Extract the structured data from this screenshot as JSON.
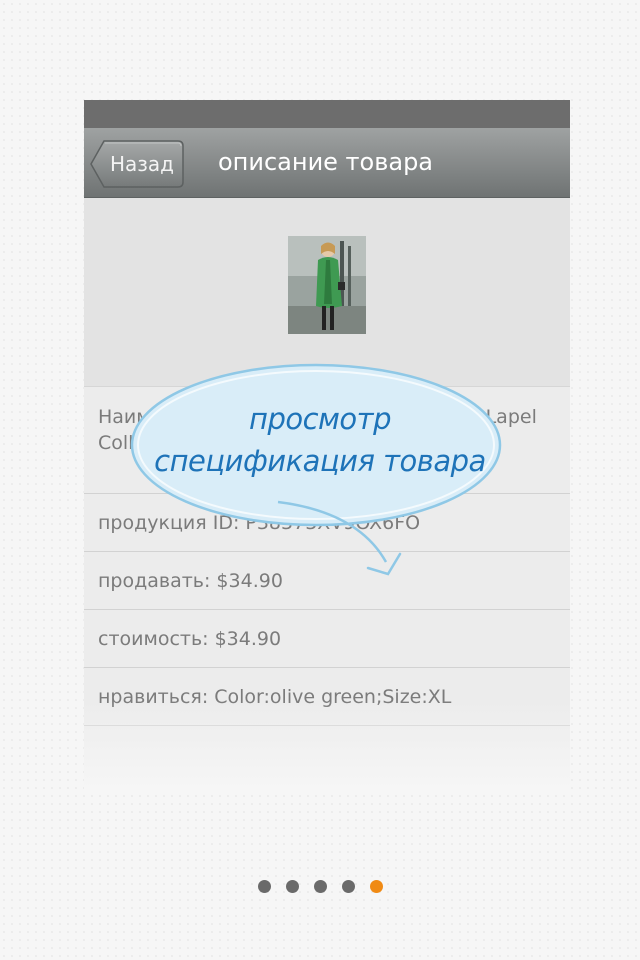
{
  "header": {
    "back_label": "Назад",
    "title": "описание товара"
  },
  "product": {
    "image_alt": "product-photo",
    "name": "Наименование: Slim Wool Blend Zipper Lapel Collar Woman Green Coat",
    "product_id": "продукция ID: P38373XV9OX6FO",
    "sell_price": "продавать: $34.90",
    "cost": "стоимость: $34.90",
    "option": "нравиться: Color:olive green;Size:XL"
  },
  "callout": {
    "line1": "просмотр",
    "line2": "спецификация товара"
  },
  "pagination": {
    "total": 5,
    "active_index": 5
  },
  "colors": {
    "accent": "#f08a14",
    "callout_text": "#1e73b8",
    "callout_fill": "#d9edf8"
  }
}
